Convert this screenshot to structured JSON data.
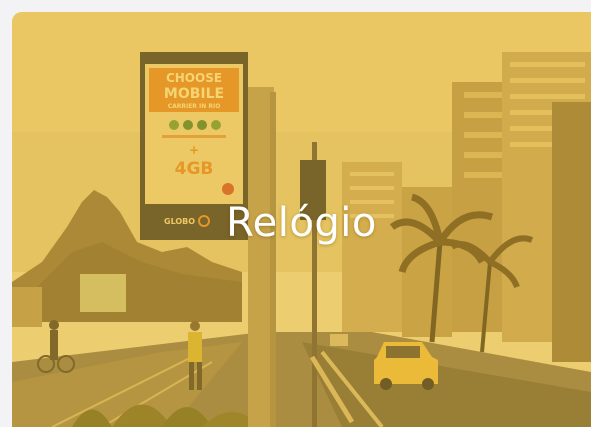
{
  "card": {
    "title": "Relógio",
    "overlay_color": "#eebc30"
  },
  "billboard": {
    "line1": "CHOOSE",
    "line2": "MOBILE",
    "line3": "CARRIER IN RIO",
    "plus": "+",
    "data": "4GB",
    "brand": "GLOBO"
  }
}
